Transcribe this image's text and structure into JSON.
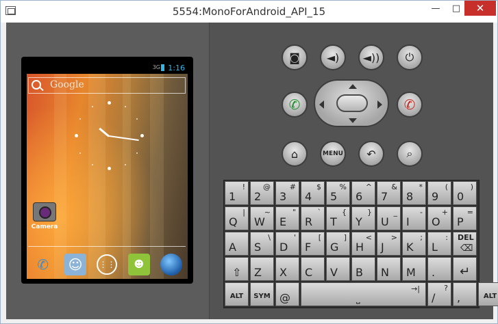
{
  "window": {
    "title": "5554:MonoForAndroid_API_15",
    "controls": {
      "minimize": "—",
      "maximize": "□",
      "close": "✕"
    }
  },
  "phone": {
    "status": {
      "network": "3G",
      "time": "1:16"
    },
    "search_label": "Google",
    "desktop_app": "Camera",
    "dock_apps": [
      "phone-icon",
      "people-icon",
      "all-apps-icon",
      "messaging-icon",
      "browser-icon"
    ]
  },
  "hardware_buttons": {
    "menu_label": "MENU"
  },
  "keyboard": {
    "row1": [
      {
        "main": "1",
        "alt": "!"
      },
      {
        "main": "2",
        "alt": "@"
      },
      {
        "main": "3",
        "alt": "#"
      },
      {
        "main": "4",
        "alt": "$"
      },
      {
        "main": "5",
        "alt": "%"
      },
      {
        "main": "6",
        "alt": "^"
      },
      {
        "main": "7",
        "alt": "&"
      },
      {
        "main": "8",
        "alt": "*"
      },
      {
        "main": "9",
        "alt": "("
      },
      {
        "main": "0",
        "alt": ")"
      }
    ],
    "row2": [
      {
        "main": "Q",
        "alt": "|"
      },
      {
        "main": "W",
        "alt": "~"
      },
      {
        "main": "E",
        "alt": "\""
      },
      {
        "main": "R",
        "alt": "`"
      },
      {
        "main": "T",
        "alt": "{"
      },
      {
        "main": "Y",
        "alt": "}"
      },
      {
        "main": "U",
        "alt": "_"
      },
      {
        "main": "I",
        "alt": "-"
      },
      {
        "main": "O",
        "alt": "+"
      },
      {
        "main": "P",
        "alt": "="
      }
    ],
    "row3": [
      {
        "main": "A",
        "alt": ""
      },
      {
        "main": "S",
        "alt": "\\"
      },
      {
        "main": "D",
        "alt": "'"
      },
      {
        "main": "F",
        "alt": "["
      },
      {
        "main": "G",
        "alt": "]"
      },
      {
        "main": "H",
        "alt": "<"
      },
      {
        "main": "J",
        "alt": ">"
      },
      {
        "main": "K",
        "alt": ";"
      },
      {
        "main": "L",
        "alt": ":"
      }
    ],
    "del_label": "DEL",
    "row4": [
      {
        "main": "Z",
        "alt": ""
      },
      {
        "main": "X",
        "alt": ""
      },
      {
        "main": "C",
        "alt": ""
      },
      {
        "main": "V",
        "alt": ""
      },
      {
        "main": "B",
        "alt": ""
      },
      {
        "main": "N",
        "alt": ""
      },
      {
        "main": "M",
        "alt": ""
      },
      {
        "main": ".",
        "alt": ""
      }
    ],
    "alt_label": "ALT",
    "sym_label": "SYM",
    "at_label": "@",
    "slash_label": "/",
    "slash_alt": "?",
    "comma_label": ","
  }
}
